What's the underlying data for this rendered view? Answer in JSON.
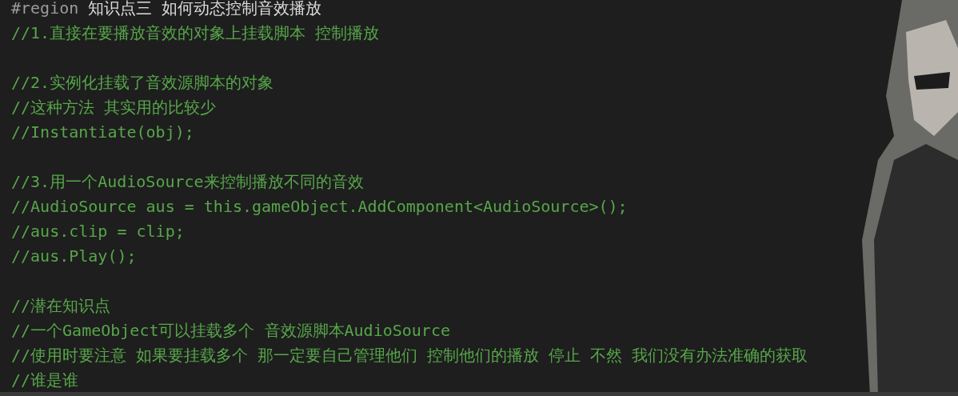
{
  "code": {
    "blocks": [
      [
        {
          "kind": "directive",
          "keyword": "#region",
          "text": "知识点三 如何动态控制音效播放"
        },
        {
          "kind": "comment",
          "text": "//1.直接在要播放音效的对象上挂载脚本 控制播放"
        }
      ],
      [
        {
          "kind": "comment",
          "text": "//2.实例化挂载了音效源脚本的对象"
        },
        {
          "kind": "comment",
          "text": "//这种方法 其实用的比较少"
        },
        {
          "kind": "comment",
          "text": "//Instantiate(obj);"
        }
      ],
      [
        {
          "kind": "comment",
          "text": "//3.用一个AudioSource来控制播放不同的音效"
        },
        {
          "kind": "comment",
          "text": "//AudioSource aus = this.gameObject.AddComponent<AudioSource>();"
        },
        {
          "kind": "comment",
          "text": "//aus.clip = clip;"
        },
        {
          "kind": "comment",
          "text": "//aus.Play();"
        }
      ],
      [
        {
          "kind": "comment",
          "text": "//潜在知识点"
        },
        {
          "kind": "comment",
          "text": "//一个GameObject可以挂载多个 音效源脚本AudioSource"
        },
        {
          "kind": "comment",
          "text": "//使用时要注意 如果要挂载多个 那一定要自己管理他们 控制他们的播放 停止 不然 我们没有办法准确的获取"
        },
        {
          "kind": "comment",
          "text": "//谁是谁"
        }
      ]
    ]
  }
}
